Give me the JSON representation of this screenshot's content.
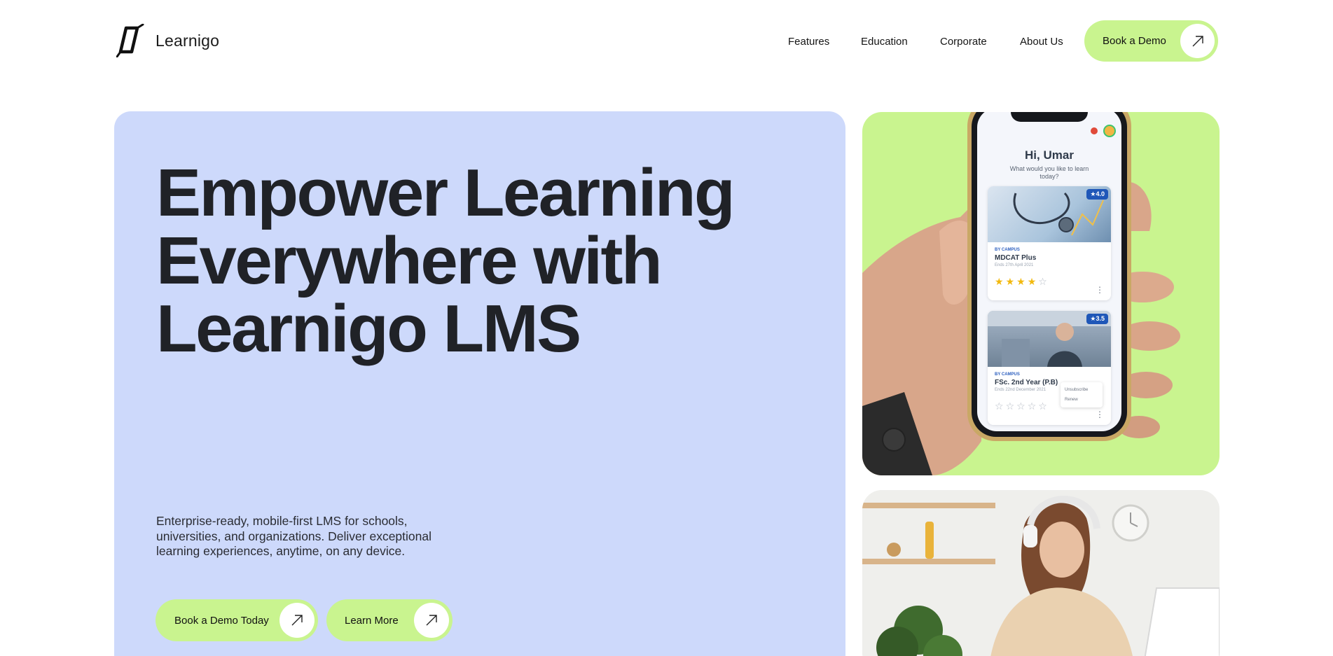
{
  "brand": {
    "name": "Learnigo"
  },
  "nav": {
    "items": [
      {
        "label": "Features"
      },
      {
        "label": "Education"
      },
      {
        "label": "Corporate"
      },
      {
        "label": "About Us"
      }
    ],
    "cta_label": "Book a Demo"
  },
  "hero": {
    "title_lines": [
      "Empower Learning",
      "Everywhere with",
      "Learnigo LMS"
    ],
    "subtitle": "Enterprise-ready, mobile-first LMS for schools, universities, and organizations. Deliver exceptional learning experiences, anytime, on any device.",
    "primary_cta": "Book a Demo Today",
    "secondary_cta": "Learn More"
  },
  "phone_app": {
    "greeting": "Hi, Umar",
    "prompt": "What would you like to learn today?",
    "courses": [
      {
        "rating": "★4.0",
        "by": "BY CAMPUS",
        "title": "MDCAT Plus",
        "date": "Ends 27th April 2021",
        "stars": 4
      },
      {
        "rating": "★3.5",
        "by": "BY CAMPUS",
        "title": "FSc. 2nd Year (P.B)",
        "date": "Ends 22nd December 2021",
        "stars": 0
      }
    ],
    "menu_options": [
      "Unsubscribe",
      "Renew"
    ]
  },
  "colors": {
    "accent_green": "#c9f48f",
    "hero_blue": "#cdd9fb",
    "text_dark": "#202227",
    "course_blue": "#1f57b8"
  },
  "icons": {
    "logo": "learnigo-logo-icon",
    "arrow": "arrow-up-right-icon"
  }
}
